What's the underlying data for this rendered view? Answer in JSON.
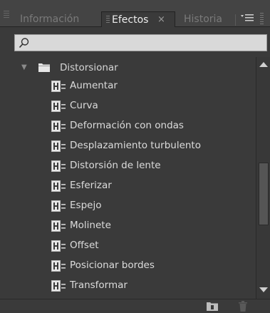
{
  "tabs": [
    {
      "label": "Información",
      "active": false
    },
    {
      "label": "Efectos",
      "active": true,
      "close": "×"
    },
    {
      "label": "Historia",
      "active": false
    }
  ],
  "search": {
    "value": "",
    "placeholder": ""
  },
  "folder": {
    "label": "Distorsionar",
    "expanded": true
  },
  "effects": [
    {
      "label": "Aumentar"
    },
    {
      "label": "Curva"
    },
    {
      "label": "Deformación con ondas"
    },
    {
      "label": "Desplazamiento turbulento"
    },
    {
      "label": "Distorsión de lente"
    },
    {
      "label": "Esferizar"
    },
    {
      "label": "Espejo"
    },
    {
      "label": "Molinete"
    },
    {
      "label": "Offset"
    },
    {
      "label": "Posicionar bordes"
    },
    {
      "label": "Transformar"
    }
  ],
  "icons": {
    "search": "search-icon",
    "folder": "folder-icon",
    "effect": "effect-icon",
    "menu": "panel-menu-icon",
    "new_bin": "new-bin-icon",
    "trash": "trash-icon"
  },
  "colors": {
    "panel_bg": "#3a3a3a",
    "text": "#dcdcdc",
    "inactive_tab_text": "#7a7a7a",
    "search_bg": "#d9d9d9"
  }
}
